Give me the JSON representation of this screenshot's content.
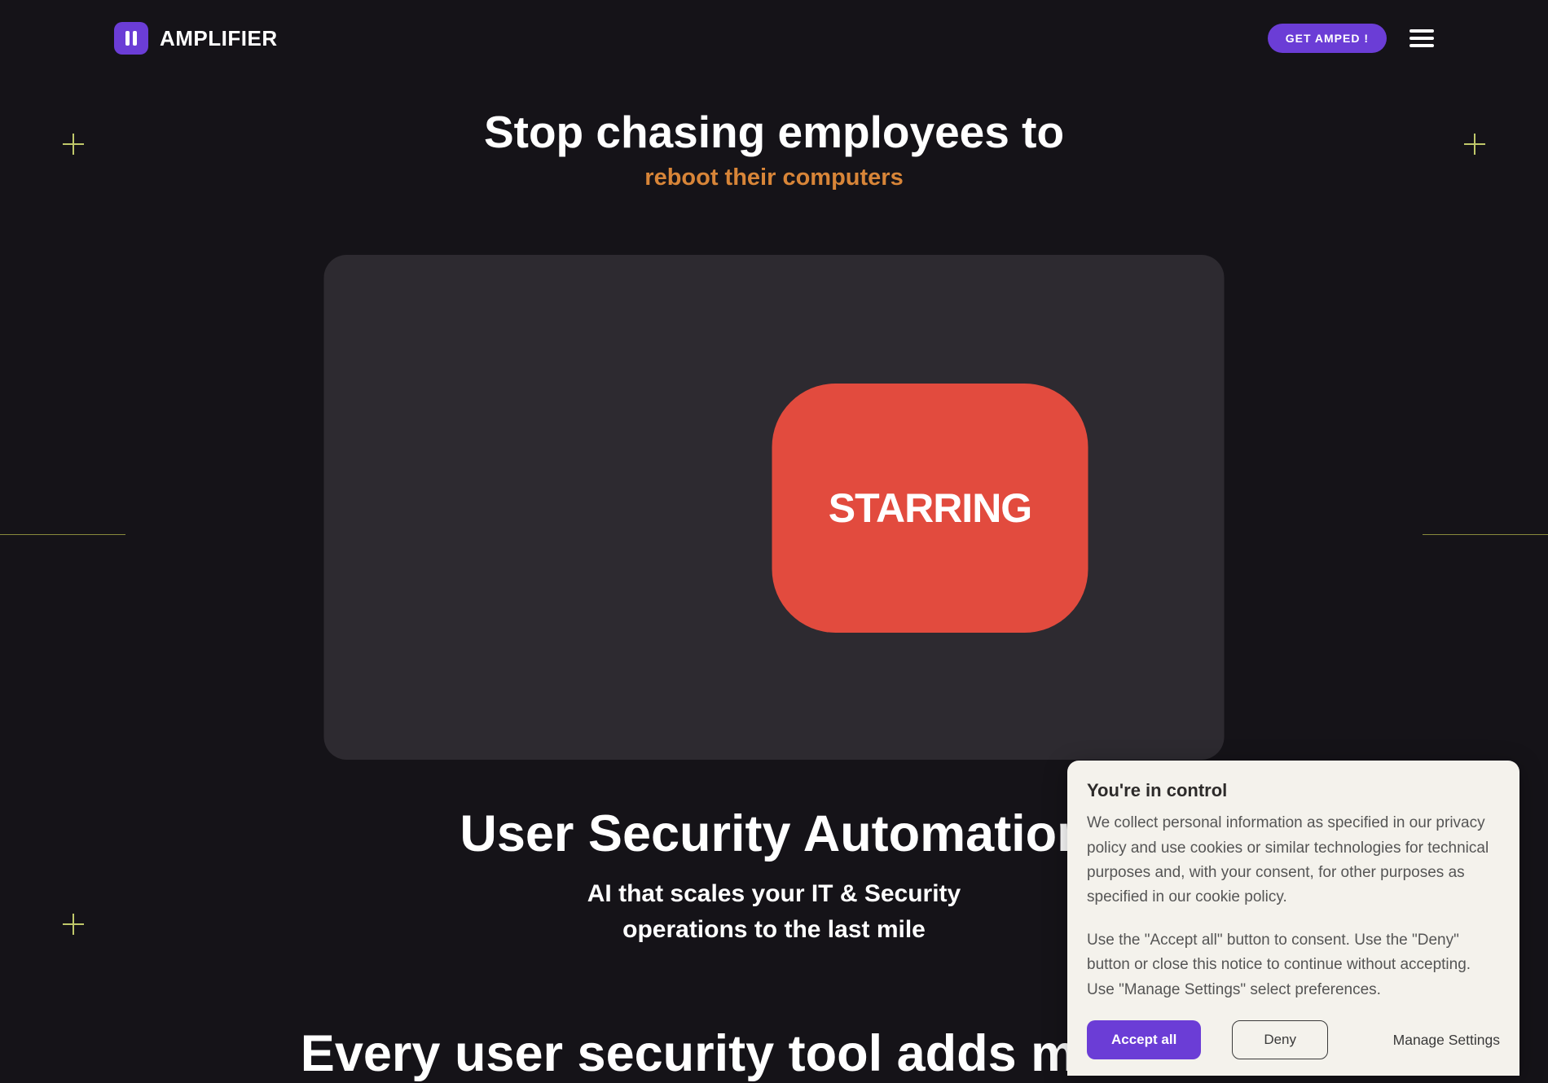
{
  "header": {
    "brand": "AMPLIFIER",
    "cta_label": "GET AMPED !"
  },
  "hero": {
    "headline": "Stop chasing employees to",
    "subhead": "reboot their computers"
  },
  "video": {
    "badge": "STARRING"
  },
  "section": {
    "title": "User Security Automation",
    "subtitle_l1": "AI that scales your IT & Security",
    "subtitle_l2": "operations to the last mile"
  },
  "teaser": {
    "partial_title": "Every user security tool adds more toil"
  },
  "cookie": {
    "title": "You're in control",
    "body1": "We collect personal information as specified in our privacy policy and use cookies or similar technologies for technical purposes and, with your consent, for other purposes as specified in our cookie policy.",
    "body2": "Use the \"Accept all\" button to consent. Use the \"Deny\" button or close this notice to continue without accepting. Use \"Manage Settings\" select preferences.",
    "accept_label": "Accept all",
    "deny_label": "Deny",
    "manage_label": "Manage Settings"
  }
}
